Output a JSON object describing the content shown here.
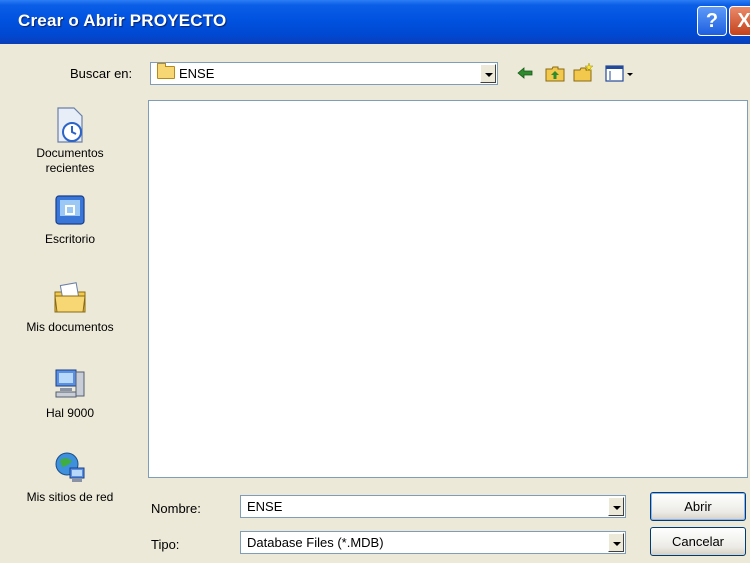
{
  "window": {
    "title": "Crear o Abrir PROYECTO",
    "help_icon": "?",
    "close_icon": "X"
  },
  "lookin": {
    "label": "Buscar en:",
    "value": "ENSE"
  },
  "toolbar": {
    "icons": [
      "back-arrow-icon",
      "up-folder-icon",
      "new-folder-icon",
      "view-menu-icon"
    ]
  },
  "places": {
    "items": [
      {
        "label_line1": "Documentos",
        "label_line2": "recientes",
        "icon": "recent-documents-icon"
      },
      {
        "label_line1": "Escritorio",
        "label_line2": "",
        "icon": "desktop-icon"
      },
      {
        "label_line1": "Mis documentos",
        "label_line2": "",
        "icon": "my-documents-icon"
      },
      {
        "label_line1": "Hal 9000",
        "label_line2": "",
        "icon": "my-computer-icon"
      },
      {
        "label_line1": "Mis sitios de red",
        "label_line2": "",
        "icon": "network-places-icon"
      }
    ]
  },
  "filename": {
    "label": "Nombre:",
    "value": "ENSE"
  },
  "filetype": {
    "label": "Tipo:",
    "value": "Database Files (*.MDB)"
  },
  "buttons": {
    "open": "Abrir",
    "cancel": "Cancelar"
  },
  "colors": {
    "titlebar": "#0052e0",
    "face": "#ece9d8",
    "close": "#c4421c"
  }
}
